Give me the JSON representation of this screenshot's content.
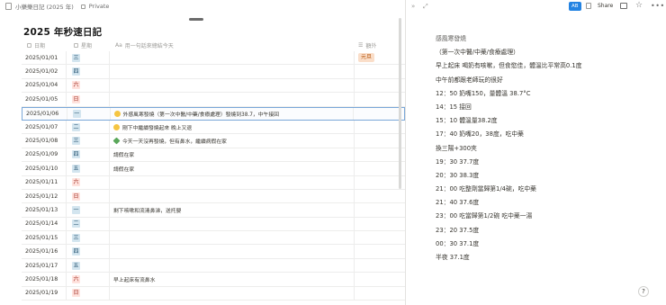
{
  "topbar": {
    "page_name": "小樂樂日記 (2025 年)",
    "visibility": "Private"
  },
  "database": {
    "title": "2025 年秒速日記",
    "columns": {
      "date": "日期",
      "weekday": "星期",
      "note": "用一句話來總結今天",
      "extra": "額外"
    },
    "rows": [
      {
        "date": "2025/01/01",
        "weekday": "三",
        "wk_color": "blue",
        "note": "",
        "extra": "元旦",
        "emoji": ""
      },
      {
        "date": "2025/01/02",
        "weekday": "四",
        "wk_color": "blue",
        "note": "",
        "extra": "",
        "emoji": ""
      },
      {
        "date": "2025/01/04",
        "weekday": "六",
        "wk_color": "red",
        "note": "",
        "extra": "",
        "emoji": ""
      },
      {
        "date": "2025/01/05",
        "weekday": "日",
        "wk_color": "red",
        "note": "",
        "extra": "",
        "emoji": ""
      },
      {
        "date": "2025/01/06",
        "weekday": "一",
        "wk_color": "blue",
        "note": "外感風寒發燒（第一次中醫/中藥/食療處理）發燒到38.7，中午接回",
        "extra": "",
        "emoji": "yellow"
      },
      {
        "date": "2025/01/07",
        "weekday": "二",
        "wk_color": "blue",
        "note": "剛下中繼續發燒起來 晚上又退",
        "extra": "",
        "emoji": "yellow"
      },
      {
        "date": "2025/01/08",
        "weekday": "三",
        "wk_color": "blue",
        "note": "今天一天沒再發燒，但有鼻水，繼續病假在家",
        "extra": "",
        "emoji": "green"
      },
      {
        "date": "2025/01/09",
        "weekday": "四",
        "wk_color": "blue",
        "note": "請假在家",
        "extra": "",
        "emoji": ""
      },
      {
        "date": "2025/01/10",
        "weekday": "五",
        "wk_color": "blue",
        "note": "請假在家",
        "extra": "",
        "emoji": ""
      },
      {
        "date": "2025/01/11",
        "weekday": "六",
        "wk_color": "red",
        "note": "",
        "extra": "",
        "emoji": ""
      },
      {
        "date": "2025/01/12",
        "weekday": "日",
        "wk_color": "red",
        "note": "",
        "extra": "",
        "emoji": ""
      },
      {
        "date": "2025/01/13",
        "weekday": "一",
        "wk_color": "blue",
        "note": "剩下咳嗽和流清鼻涕，送托嬰",
        "extra": "",
        "emoji": ""
      },
      {
        "date": "2025/01/14",
        "weekday": "二",
        "wk_color": "blue",
        "note": "",
        "extra": "",
        "emoji": ""
      },
      {
        "date": "2025/01/15",
        "weekday": "三",
        "wk_color": "blue",
        "note": "",
        "extra": "",
        "emoji": ""
      },
      {
        "date": "2025/01/16",
        "weekday": "四",
        "wk_color": "blue",
        "note": "",
        "extra": "",
        "emoji": ""
      },
      {
        "date": "2025/01/17",
        "weekday": "五",
        "wk_color": "blue",
        "note": "",
        "extra": "",
        "emoji": ""
      },
      {
        "date": "2025/01/18",
        "weekday": "六",
        "wk_color": "red",
        "note": "早上起床有流鼻水",
        "extra": "",
        "emoji": ""
      },
      {
        "date": "2025/01/19",
        "weekday": "日",
        "wk_color": "red",
        "note": "",
        "extra": "",
        "emoji": ""
      }
    ]
  },
  "side_peek": {
    "toolbar": {
      "ai_label": "AB",
      "share_label": "Share"
    },
    "lines": [
      "感風寒發燒",
      "（第一次中醫/中藥/食療處理）",
      "早上起床 喝奶有咳嗽，但食慾佳，體溫比平常高0.1度",
      "中午前都跟老師玩的很好",
      "12：50 奶嘴150，量體溫 38.7°C",
      "14：15 接回",
      "15：10 體溫量38.2度",
      "17：40 奶嘴20，38度，吃中藥",
      "換三陽+300夾",
      "19：30 37.7度",
      "20：30 38.3度",
      "21：00 吃整劑當歸第1/4碗，吃中藥",
      "21：40 37.6度",
      "23：00 吃當歸第1/2碗 吃中藥一湯",
      "23：20 37.5度",
      "00：30 37.1度",
      "半夜 37.1度"
    ]
  },
  "colors": {
    "accent": "#2383e2",
    "weekday_blue": "#d3e5ef",
    "weekday_red": "#ffe2dd",
    "tag_orange": "#fadec9"
  }
}
